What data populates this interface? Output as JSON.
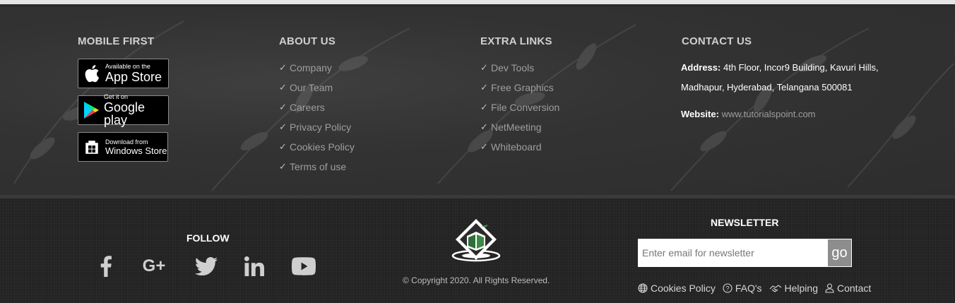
{
  "mobile": {
    "title": "MOBILE FIRST",
    "badges": [
      {
        "small": "Available on the",
        "big": "App Store",
        "icon": "apple-icon"
      },
      {
        "small": "Get it on",
        "big": "Google play",
        "icon": "google-play-icon"
      },
      {
        "small": "Download from",
        "big": "Windows Store",
        "icon": "windows-icon"
      }
    ]
  },
  "about": {
    "title": "ABOUT US",
    "links": [
      "Company",
      "Our Team",
      "Careers",
      "Privacy Policy",
      "Cookies Policy",
      "Terms of use"
    ]
  },
  "extra": {
    "title": "EXTRA LINKS",
    "links": [
      "Dev Tools",
      "Free Graphics",
      "File Conversion",
      "NetMeeting",
      "Whiteboard"
    ]
  },
  "contact": {
    "title": "CONTACT US",
    "address_label": "Address:",
    "address_value": "4th Floor, Incor9 Building, Kavuri Hills, Madhapur, Hyderabad, Telangana 500081",
    "website_label": "Website:",
    "website_value": "www.tutorialspoint.com"
  },
  "follow": {
    "title": "FOLLOW",
    "icons": [
      "facebook-icon",
      "google-plus-icon",
      "twitter-icon",
      "linkedin-icon",
      "youtube-icon"
    ]
  },
  "copyright": "© Copyright 2020. All Rights Reserved.",
  "newsletter": {
    "title": "NEWSLETTER",
    "placeholder": "Enter email for newsletter",
    "button": "go"
  },
  "bottom_links": [
    {
      "label": "Cookies Policy",
      "icon": "globe-icon"
    },
    {
      "label": "FAQ's",
      "icon": "question-circle-icon"
    },
    {
      "label": "Helping",
      "icon": "handshake-icon"
    },
    {
      "label": "Contact",
      "icon": "user-icon"
    }
  ],
  "colors": {
    "upper_bg": "#333333",
    "lower_bg": "#232323",
    "link_text": "#9e9e9e",
    "go_button": "#8d8d8d"
  }
}
